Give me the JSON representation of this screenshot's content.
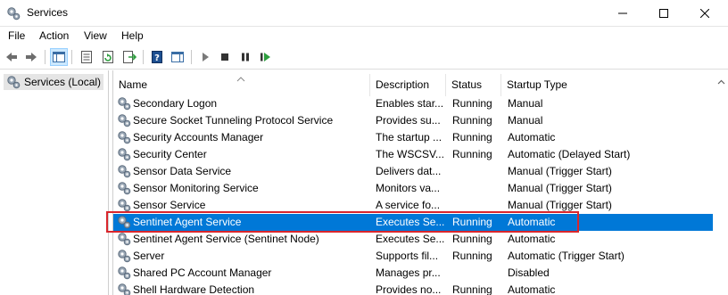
{
  "window": {
    "title": "Services"
  },
  "menu": {
    "items": [
      "File",
      "Action",
      "View",
      "Help"
    ]
  },
  "tree": {
    "root_label": "Services (Local)"
  },
  "table": {
    "columns": [
      "Name",
      "Description",
      "Status",
      "Startup Type"
    ],
    "rows": [
      {
        "name": "Secondary Logon",
        "description": "Enables star...",
        "status": "Running",
        "startup": "Manual"
      },
      {
        "name": "Secure Socket Tunneling Protocol Service",
        "description": "Provides su...",
        "status": "Running",
        "startup": "Manual"
      },
      {
        "name": "Security Accounts Manager",
        "description": "The startup ...",
        "status": "Running",
        "startup": "Automatic"
      },
      {
        "name": "Security Center",
        "description": "The WSCSV...",
        "status": "Running",
        "startup": "Automatic (Delayed Start)"
      },
      {
        "name": "Sensor Data Service",
        "description": "Delivers dat...",
        "status": "",
        "startup": "Manual (Trigger Start)"
      },
      {
        "name": "Sensor Monitoring Service",
        "description": "Monitors va...",
        "status": "",
        "startup": "Manual (Trigger Start)"
      },
      {
        "name": "Sensor Service",
        "description": "A service fo...",
        "status": "",
        "startup": "Manual (Trigger Start)"
      },
      {
        "name": "Sentinet Agent Service",
        "description": "Executes Se...",
        "status": "Running",
        "startup": "Automatic",
        "selected": true
      },
      {
        "name": "Sentinet Agent Service (Sentinet Node)",
        "description": "Executes Se...",
        "status": "Running",
        "startup": "Automatic"
      },
      {
        "name": "Server",
        "description": "Supports fil...",
        "status": "Running",
        "startup": "Automatic (Trigger Start)"
      },
      {
        "name": "Shared PC Account Manager",
        "description": "Manages pr...",
        "status": "",
        "startup": "Disabled"
      },
      {
        "name": "Shell Hardware Detection",
        "description": "Provides no...",
        "status": "Running",
        "startup": "Automatic"
      }
    ]
  },
  "colors": {
    "selection": "#0078d7",
    "highlight_border": "#d9262c",
    "accent": "#1a73c8"
  },
  "icons": {
    "title": "services-gear-icon",
    "back": "back-arrow-icon",
    "forward": "forward-arrow-icon",
    "row": "gear-icon"
  }
}
